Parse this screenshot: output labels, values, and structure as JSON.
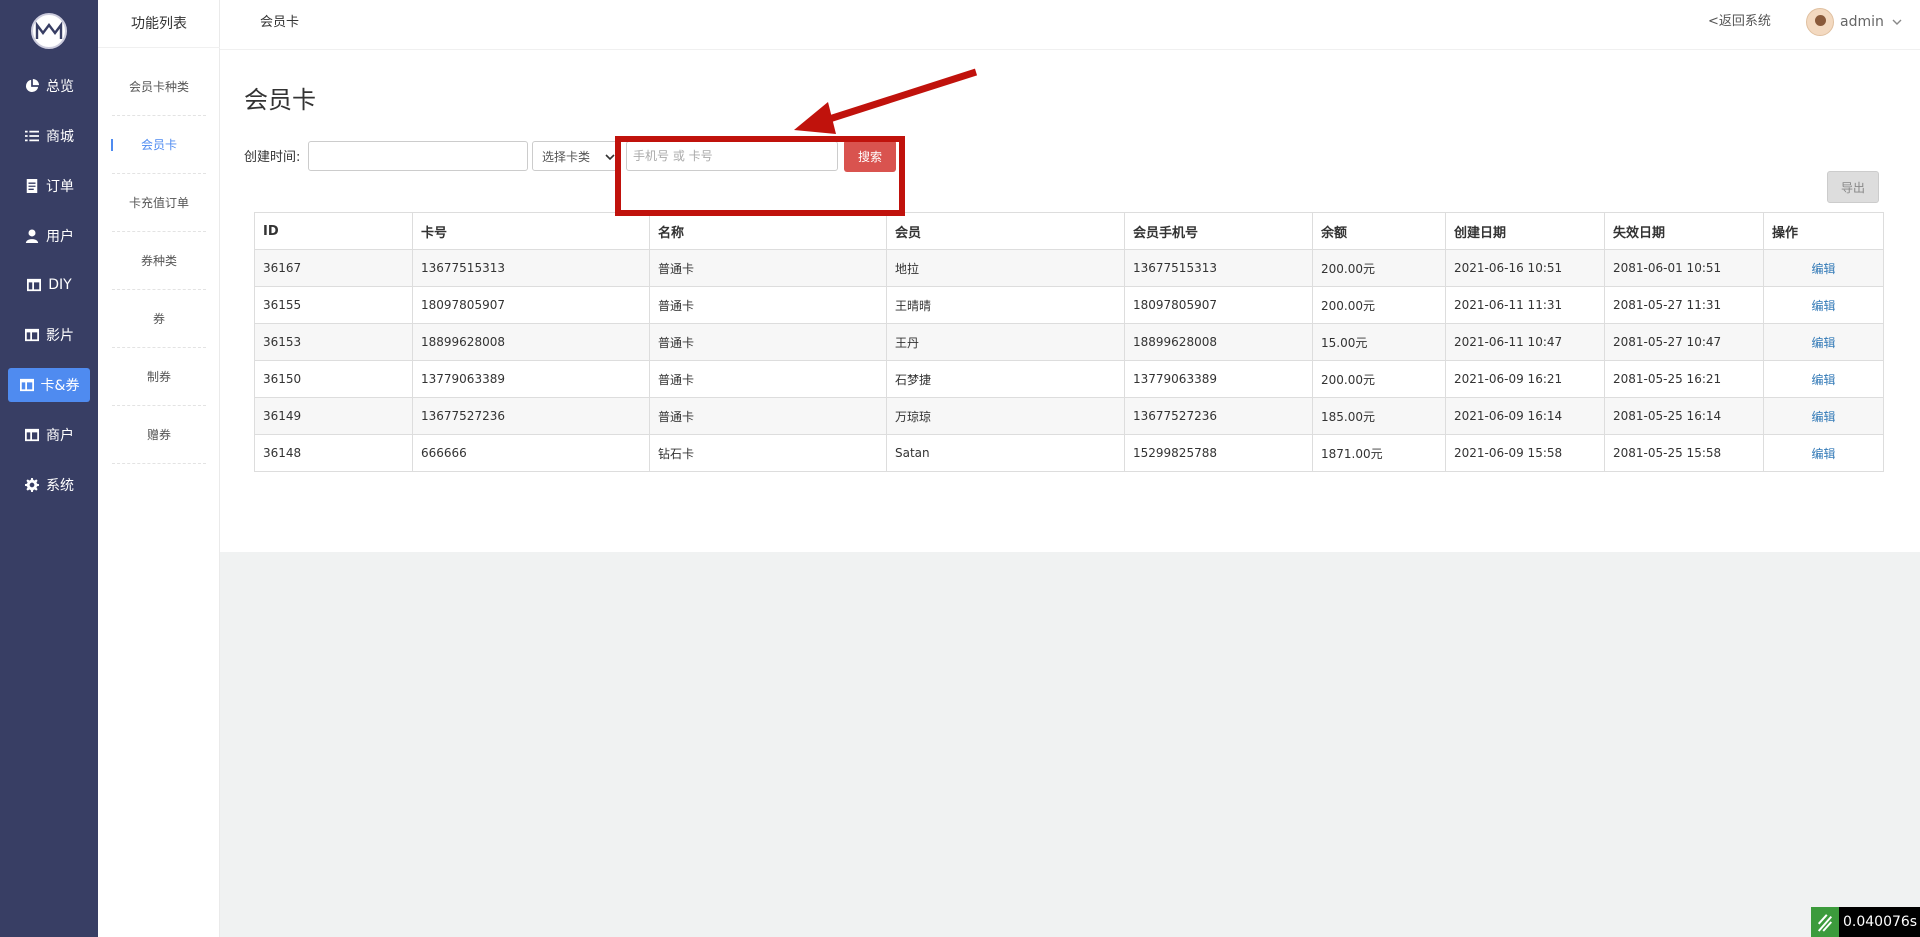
{
  "nav": {
    "items": [
      {
        "label": "总览",
        "icon": "pie-chart-icon"
      },
      {
        "label": "商城",
        "icon": "list-icon"
      },
      {
        "label": "订单",
        "icon": "document-icon"
      },
      {
        "label": "用户",
        "icon": "user-icon"
      },
      {
        "label": "DIY",
        "icon": "layout-icon"
      },
      {
        "label": "影片",
        "icon": "layout-icon"
      },
      {
        "label": "卡&券",
        "icon": "layout-icon"
      },
      {
        "label": "商户",
        "icon": "layout-icon"
      },
      {
        "label": "系统",
        "icon": "gear-icon"
      }
    ],
    "active_index": 6,
    "active_color": "#4f8bf0",
    "background": "#383e64"
  },
  "subnav": {
    "title": "功能列表",
    "items": [
      "会员卡种类",
      "会员卡",
      "卡充值订单",
      "券种类",
      "券",
      "制券",
      "赠券"
    ],
    "active_index": 1
  },
  "topbar": {
    "breadcrumb": "会员卡",
    "back_link": "<返回系统",
    "username": "admin"
  },
  "page": {
    "title": "会员卡",
    "filter_label": "创建时间:",
    "date_value": "",
    "type_select": "选择卡类",
    "search_placeholder": "手机号 或 卡号",
    "search_value": "",
    "search_button": "搜索",
    "export_button": "导出"
  },
  "table": {
    "headers": [
      "ID",
      "卡号",
      "名称",
      "会员",
      "会员手机号",
      "余额",
      "创建日期",
      "失效日期",
      "操作"
    ],
    "rows": [
      {
        "id": "36167",
        "card": "13677515313",
        "name": "普通卡",
        "member": "地拉",
        "phone": "13677515313",
        "balance": "200.00元",
        "created": "2021-06-16 10:51",
        "expires": "2081-06-01 10:51",
        "action": "编辑"
      },
      {
        "id": "36155",
        "card": "18097805907",
        "name": "普通卡",
        "member": "王晴晴",
        "phone": "18097805907",
        "balance": "200.00元",
        "created": "2021-06-11 11:31",
        "expires": "2081-05-27 11:31",
        "action": "编辑"
      },
      {
        "id": "36153",
        "card": "18899628008",
        "name": "普通卡",
        "member": "王丹",
        "phone": "18899628008",
        "balance": "15.00元",
        "created": "2021-06-11 10:47",
        "expires": "2081-05-27 10:47",
        "action": "编辑"
      },
      {
        "id": "36150",
        "card": "13779063389",
        "name": "普通卡",
        "member": "石梦捷",
        "phone": "13779063389",
        "balance": "200.00元",
        "created": "2021-06-09 16:21",
        "expires": "2081-05-25 16:21",
        "action": "编辑"
      },
      {
        "id": "36149",
        "card": "13677527236",
        "name": "普通卡",
        "member": "万琼琼",
        "phone": "13677527236",
        "balance": "185.00元",
        "created": "2021-06-09 16:14",
        "expires": "2081-05-25 16:14",
        "action": "编辑"
      },
      {
        "id": "36148",
        "card": "666666",
        "name": "钻石卡",
        "member": "Satan",
        "phone": "15299825788",
        "balance": "1871.00元",
        "created": "2021-06-09 15:58",
        "expires": "2081-05-25 15:58",
        "action": "编辑"
      }
    ]
  },
  "timer": "0.040076s",
  "colors": {
    "search_button": "#d9534f",
    "annotation": "#c0120c",
    "link": "#337ab7"
  }
}
